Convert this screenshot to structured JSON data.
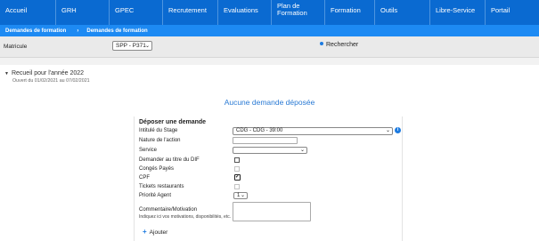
{
  "nav": {
    "items": [
      {
        "label": "Accueil"
      },
      {
        "label": "GRH"
      },
      {
        "label": "GPEC"
      },
      {
        "label": "Recrutement"
      },
      {
        "label": "Evaluations"
      },
      {
        "label": "Plan de Formation"
      },
      {
        "label": "Formation"
      },
      {
        "label": "Outils"
      },
      {
        "label": "Libre-Service"
      },
      {
        "label": "Portail"
      }
    ]
  },
  "breadcrumb": {
    "first": "Demandes de formation",
    "separator": "›",
    "second": "Demandes de formation"
  },
  "filter": {
    "matricule_label": "Matricule",
    "matricule_value": "SPP - P371",
    "search_label": "Rechercher"
  },
  "recueil": {
    "title": "Recueil pour l'année 2022",
    "period": "Ouvert du 01/02/2021 au 07/02/2021"
  },
  "empty_message": "Aucune demande déposée",
  "form": {
    "title": "Déposer une demande",
    "intitule_label": "Intitulé du Stage",
    "intitule_value": "CDG - CDG - 39:00",
    "nature_label": "Nature de l'action",
    "service_label": "Service",
    "dif_label": "Demander au titre du DIF",
    "conges_label": "Congés Payés",
    "cpf_label": "CPF",
    "tickets_label": "Tickets restaurants",
    "priorite_label": "Priorité Agent",
    "priorite_value": "1",
    "commentaire_label": "Commentaire/Motivation",
    "commentaire_hint": "Indiquez ici vos motivations, disponibilités, etc.",
    "ajouter_label": "Ajouter",
    "cpf_checked": true,
    "dif_checked": false
  },
  "colors": {
    "nav_bg": "#0a6ad1",
    "crumb_bg": "#1d8af3",
    "accent": "#1d7be0"
  }
}
